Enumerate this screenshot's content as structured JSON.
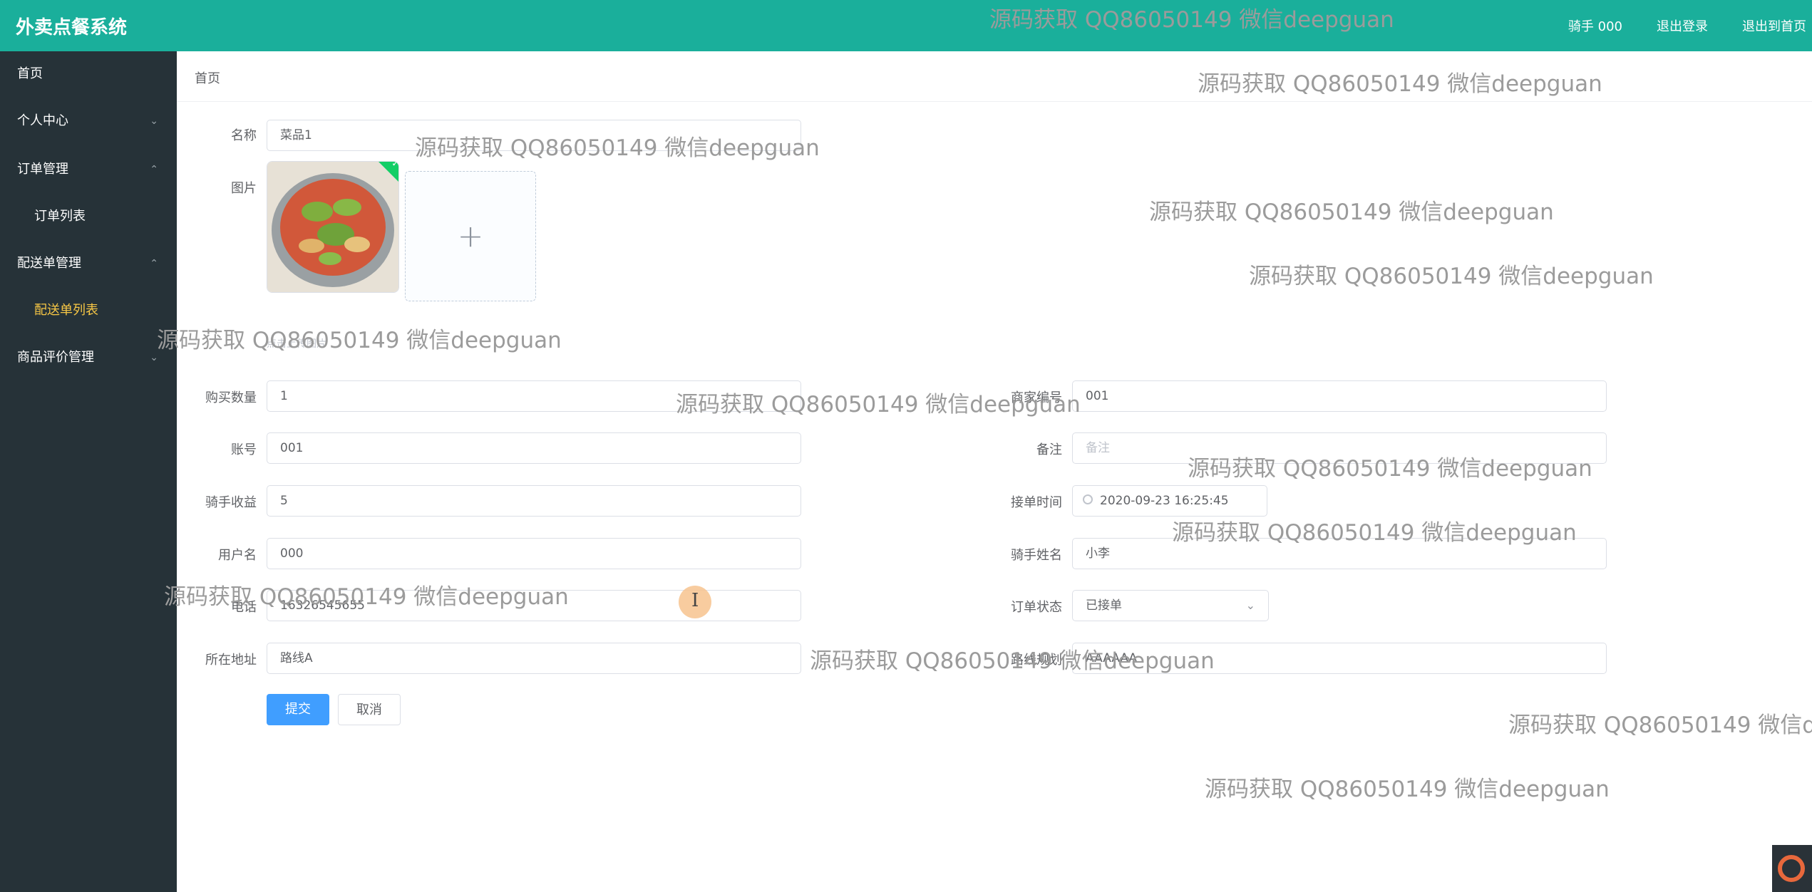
{
  "header": {
    "app_title": "外卖点餐系统",
    "user_label": "骑手 000",
    "logout_label": "退出登录",
    "home_exit_label": "退出到首页"
  },
  "sidebar": {
    "items": [
      {
        "label": "首页"
      },
      {
        "label": "个人中心"
      },
      {
        "label": "订单管理"
      },
      {
        "label": "订单列表"
      },
      {
        "label": "配送单管理"
      },
      {
        "label": "配送单列表"
      },
      {
        "label": "商品评价管理"
      }
    ]
  },
  "breadcrumb": "首页",
  "form": {
    "name_label": "名称",
    "name_value": "菜品1",
    "image_label": "图片",
    "upload_hint": "点击上传图片",
    "quantity_label": "购买数量",
    "quantity_value": "1",
    "merchant_label": "商家编号",
    "merchant_value": "001",
    "account_label": "账号",
    "account_value": "001",
    "remark_label": "备注",
    "remark_placeholder": "备注",
    "income_label": "骑手收益",
    "income_value": "5",
    "accept_time_label": "接单时间",
    "accept_time_value": "2020-09-23 16:25:45",
    "username_label": "用户名",
    "username_value": "000",
    "rider_name_label": "骑手姓名",
    "rider_name_value": "小李",
    "phone_label": "电话",
    "phone_value": "16326545655",
    "order_status_label": "订单状态",
    "order_status_value": "已接单",
    "address_label": "所在地址",
    "address_value": "路线A",
    "route_label": "路线规划",
    "route_value": "AAAAAA",
    "submit_label": "提交",
    "cancel_label": "取消"
  },
  "watermark": "源码获取 QQ86050149 微信deepguan",
  "icons": {
    "chevron": "chevron-icon",
    "plus": "plus-icon",
    "clock": "clock-icon",
    "check": "check-icon"
  },
  "colors": {
    "header_bg": "#1aaf9b",
    "sidebar_bg": "#263238",
    "active_menu": "#f7c745",
    "primary": "#409eff"
  }
}
